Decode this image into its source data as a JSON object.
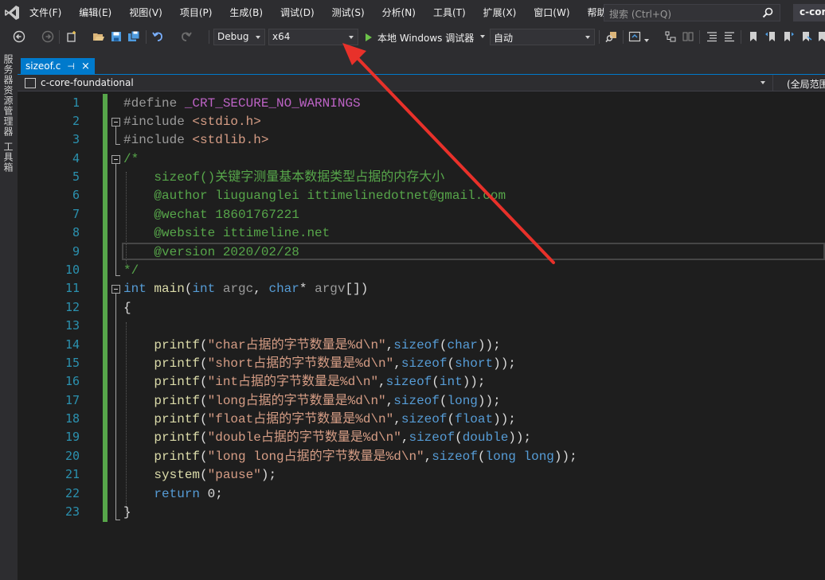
{
  "menubar": {
    "items": [
      "文件(F)",
      "编辑(E)",
      "视图(V)",
      "项目(P)",
      "生成(B)",
      "调试(D)",
      "测试(S)",
      "分析(N)",
      "工具(T)",
      "扩展(X)",
      "窗口(W)",
      "帮助(H)"
    ],
    "search_placeholder": "搜索 (Ctrl+Q)",
    "solution_name": "c-core"
  },
  "toolbar": {
    "configuration": "Debug",
    "platform": "x64",
    "run_label": "本地 Windows 调试器",
    "run_mode": "自动"
  },
  "side_panel": {
    "tabs": [
      "服务器资源管理器",
      "工具箱"
    ]
  },
  "tab": {
    "filename": "sizeof.c",
    "pin": "⊣",
    "close": "×"
  },
  "navbar": {
    "project": "c-core-foundational",
    "scope": "(全局范围)"
  },
  "editor": {
    "line_numbers": [
      "1",
      "2",
      "3",
      "4",
      "5",
      "6",
      "7",
      "8",
      "9",
      "10",
      "11",
      "12",
      "13",
      "14",
      "15",
      "16",
      "17",
      "18",
      "19",
      "20",
      "21",
      "22",
      "23"
    ],
    "code": {
      "l1": {
        "a": "#define ",
        "b": "_CRT_SECURE_NO_WARNINGS"
      },
      "l2": {
        "a": "#include ",
        "b": "<stdio.h>"
      },
      "l3": {
        "a": "#include ",
        "b": "<stdlib.h>"
      },
      "l4": {
        "a": "/*"
      },
      "l5": {
        "a": "    sizeof()关键字测量基本数据类型占据的内存大小"
      },
      "l6": {
        "a": "    @author liuguanglei ittimelinedotnet@gmail.com"
      },
      "l7": {
        "a": "    @wechat 18601767221"
      },
      "l8": {
        "a": "    @website ittimeline.net"
      },
      "l9": {
        "a": "    @version 2020/02/28"
      },
      "l10": {
        "a": "*/"
      },
      "l11": {
        "kw1": "int",
        "fn": " main",
        "p1": "(",
        "kw2": "int",
        "arg1": " argc",
        "c1": ", ",
        "kw3": "char",
        "star": "*",
        "arg2": " argv",
        "p2": "[])"
      },
      "l12": {
        "a": "{"
      },
      "l14": {
        "fn": "    printf",
        "p": "(",
        "s": "\"char占据的字节数量是%d\\n\"",
        "c": ",",
        "kw": "sizeof",
        "o": "(",
        "t": "char",
        "e": "));"
      },
      "l15": {
        "fn": "    printf",
        "p": "(",
        "s": "\"short占据的字节数量是%d\\n\"",
        "c": ",",
        "kw": "sizeof",
        "o": "(",
        "t": "short",
        "e": "));"
      },
      "l16": {
        "fn": "    printf",
        "p": "(",
        "s": "\"int占据的字节数量是%d\\n\"",
        "c": ",",
        "kw": "sizeof",
        "o": "(",
        "t": "int",
        "e": "));"
      },
      "l17": {
        "fn": "    printf",
        "p": "(",
        "s": "\"long占据的字节数量是%d\\n\"",
        "c": ",",
        "kw": "sizeof",
        "o": "(",
        "t": "long",
        "e": "));"
      },
      "l18": {
        "fn": "    printf",
        "p": "(",
        "s": "\"float占据的字节数量是%d\\n\"",
        "c": ",",
        "kw": "sizeof",
        "o": "(",
        "t": "float",
        "e": "));"
      },
      "l19": {
        "fn": "    printf",
        "p": "(",
        "s": "\"double占据的字节数量是%d\\n\"",
        "c": ",",
        "kw": "sizeof",
        "o": "(",
        "t": "double",
        "e": "));"
      },
      "l20": {
        "fn": "    printf",
        "p": "(",
        "s": "\"long long占据的字节数量是%d\\n\"",
        "c": ",",
        "kw": "sizeof",
        "o": "(",
        "t": "long long",
        "e": "));"
      },
      "l21": {
        "fn": "    system",
        "p": "(",
        "s": "\"pause\"",
        "e": ");"
      },
      "l22": {
        "kw": "    return",
        "v": " 0;"
      },
      "l23": {
        "a": "}"
      }
    }
  },
  "colors": {
    "accent": "#007acc",
    "annotation_arrow": "#e8312a",
    "keyword": "#569cd6",
    "comment": "#57a64a",
    "string": "#d69d85"
  }
}
